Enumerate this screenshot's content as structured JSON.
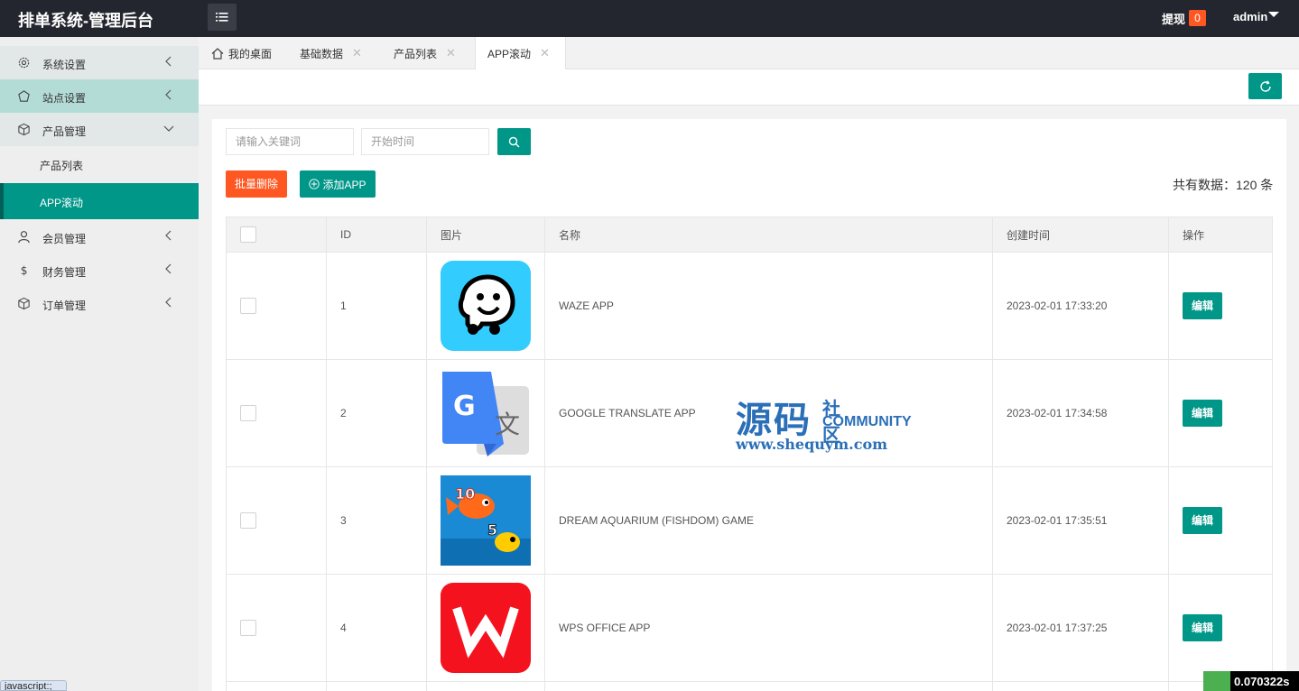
{
  "header": {
    "app_title": "排单系统-管理后台",
    "withdraw_label": "提现",
    "withdraw_count": "0",
    "username": "admin"
  },
  "sidebar": {
    "items": [
      {
        "label": "系统设置",
        "icon": "gear-icon"
      },
      {
        "label": "站点设置",
        "icon": "site-icon"
      },
      {
        "label": "产品管理",
        "icon": "cube-icon"
      },
      {
        "label": "产品列表"
      },
      {
        "label": "APP滚动"
      },
      {
        "label": "会员管理",
        "icon": "user-icon"
      },
      {
        "label": "财务管理",
        "icon": "dollar-icon"
      },
      {
        "label": "订单管理",
        "icon": "cube-icon"
      }
    ]
  },
  "tabs": [
    {
      "label": "我的桌面",
      "icon": "home-icon"
    },
    {
      "label": "基础数据"
    },
    {
      "label": "产品列表"
    },
    {
      "label": "APP滚动"
    }
  ],
  "filters": {
    "keyword_placeholder": "请输入关键词",
    "start_time_placeholder": "开始时间"
  },
  "actions": {
    "batch_delete": "批量删除",
    "add_app": "添加APP",
    "total": "共有数据：120 条"
  },
  "table": {
    "headers": [
      "ID",
      "图片",
      "名称",
      "创建时间",
      "操作"
    ],
    "rows": [
      {
        "id": "1",
        "name": "WAZE APP",
        "created": "2023-02-01 17:33:20",
        "action": "编辑",
        "image": "waze-icon"
      },
      {
        "id": "2",
        "name": "GOOGLE TRANSLATE APP",
        "created": "2023-02-01 17:34:58",
        "action": "编辑",
        "image": "google-translate-icon"
      },
      {
        "id": "3",
        "name": "DREAM AQUARIUM (FISHDOM) GAME",
        "created": "2023-02-01 17:35:51",
        "action": "编辑",
        "image": "fishdom-icon"
      },
      {
        "id": "4",
        "name": "WPS OFFICE APP",
        "created": "2023-02-01 17:37:25",
        "action": "编辑",
        "image": "wps-icon"
      }
    ]
  },
  "watermark": {
    "big": "源码",
    "cn": "社区",
    "en": "COMMUNITY",
    "url": "www.shequym.com"
  },
  "statusbar": {
    "link": "javascript:;",
    "timer": "0.070322s"
  },
  "colors": {
    "accent": "#009688",
    "danger": "#ff5722",
    "header": "#23262e"
  }
}
